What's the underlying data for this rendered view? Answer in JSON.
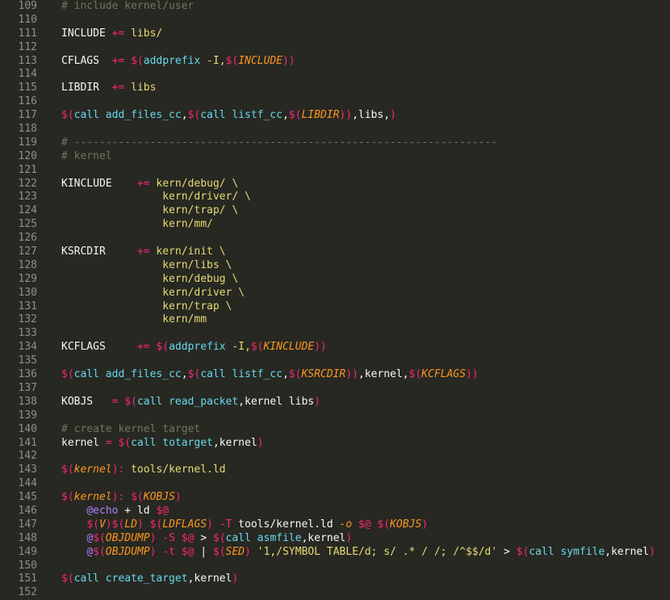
{
  "editor": {
    "lines": [
      {
        "n": "109",
        "tokens": [
          [
            "comment",
            "# include kernel/user"
          ]
        ]
      },
      {
        "n": "110",
        "tokens": []
      },
      {
        "n": "111",
        "tokens": [
          [
            "plain",
            "INCLUDE "
          ],
          [
            "op",
            "+="
          ],
          [
            "plain",
            " "
          ],
          [
            "string",
            "libs/"
          ]
        ]
      },
      {
        "n": "112",
        "tokens": []
      },
      {
        "n": "113",
        "tokens": [
          [
            "plain",
            "CFLAGS  "
          ],
          [
            "op",
            "+="
          ],
          [
            "plain",
            " "
          ],
          [
            "dollar",
            "$("
          ],
          [
            "func",
            "addprefix"
          ],
          [
            "string",
            " -I,"
          ],
          [
            "dollar",
            "$("
          ],
          [
            "var",
            "INCLUDE"
          ],
          [
            "paren",
            "))"
          ]
        ]
      },
      {
        "n": "114",
        "tokens": []
      },
      {
        "n": "115",
        "tokens": [
          [
            "plain",
            "LIBDIR  "
          ],
          [
            "op",
            "+="
          ],
          [
            "plain",
            " "
          ],
          [
            "string",
            "libs"
          ]
        ]
      },
      {
        "n": "116",
        "tokens": []
      },
      {
        "n": "117",
        "tokens": [
          [
            "dollar",
            "$("
          ],
          [
            "func",
            "call add_files_cc"
          ],
          [
            "plain",
            ","
          ],
          [
            "dollar",
            "$("
          ],
          [
            "func",
            "call listf_cc"
          ],
          [
            "plain",
            ","
          ],
          [
            "dollar",
            "$("
          ],
          [
            "var",
            "LIBDIR"
          ],
          [
            "paren",
            "))"
          ],
          [
            "plain",
            ",libs,"
          ],
          [
            "paren",
            ")"
          ]
        ]
      },
      {
        "n": "118",
        "tokens": []
      },
      {
        "n": "119",
        "tokens": [
          [
            "comment",
            "# -------------------------------------------------------------------"
          ]
        ]
      },
      {
        "n": "120",
        "tokens": [
          [
            "comment",
            "# kernel"
          ]
        ]
      },
      {
        "n": "121",
        "tokens": []
      },
      {
        "n": "122",
        "tokens": [
          [
            "plain",
            "KINCLUDE    "
          ],
          [
            "op",
            "+="
          ],
          [
            "plain",
            " "
          ],
          [
            "string",
            "kern/debug/ \\"
          ]
        ]
      },
      {
        "n": "123",
        "tokens": [
          [
            "plain",
            "                "
          ],
          [
            "string",
            "kern/driver/ \\"
          ]
        ]
      },
      {
        "n": "124",
        "tokens": [
          [
            "plain",
            "                "
          ],
          [
            "string",
            "kern/trap/ \\"
          ]
        ]
      },
      {
        "n": "125",
        "tokens": [
          [
            "plain",
            "                "
          ],
          [
            "string",
            "kern/mm/"
          ]
        ]
      },
      {
        "n": "126",
        "tokens": []
      },
      {
        "n": "127",
        "tokens": [
          [
            "plain",
            "KSRCDIR     "
          ],
          [
            "op",
            "+="
          ],
          [
            "plain",
            " "
          ],
          [
            "string",
            "kern/init \\"
          ]
        ]
      },
      {
        "n": "128",
        "tokens": [
          [
            "plain",
            "                "
          ],
          [
            "string",
            "kern/libs \\"
          ]
        ]
      },
      {
        "n": "129",
        "tokens": [
          [
            "plain",
            "                "
          ],
          [
            "string",
            "kern/debug \\"
          ]
        ]
      },
      {
        "n": "130",
        "tokens": [
          [
            "plain",
            "                "
          ],
          [
            "string",
            "kern/driver \\"
          ]
        ]
      },
      {
        "n": "131",
        "tokens": [
          [
            "plain",
            "                "
          ],
          [
            "string",
            "kern/trap \\"
          ]
        ]
      },
      {
        "n": "132",
        "tokens": [
          [
            "plain",
            "                "
          ],
          [
            "string",
            "kern/mm"
          ]
        ]
      },
      {
        "n": "133",
        "tokens": []
      },
      {
        "n": "134",
        "tokens": [
          [
            "plain",
            "KCFLAGS     "
          ],
          [
            "op",
            "+="
          ],
          [
            "plain",
            " "
          ],
          [
            "dollar",
            "$("
          ],
          [
            "func",
            "addprefix"
          ],
          [
            "string",
            " -I,"
          ],
          [
            "dollar",
            "$("
          ],
          [
            "var",
            "KINCLUDE"
          ],
          [
            "paren",
            "))"
          ]
        ]
      },
      {
        "n": "135",
        "tokens": []
      },
      {
        "n": "136",
        "tokens": [
          [
            "dollar",
            "$("
          ],
          [
            "func",
            "call add_files_cc"
          ],
          [
            "plain",
            ","
          ],
          [
            "dollar",
            "$("
          ],
          [
            "func",
            "call listf_cc"
          ],
          [
            "plain",
            ","
          ],
          [
            "dollar",
            "$("
          ],
          [
            "var",
            "KSRCDIR"
          ],
          [
            "paren",
            "))"
          ],
          [
            "plain",
            ",kernel,"
          ],
          [
            "dollar",
            "$("
          ],
          [
            "var",
            "KCFLAGS"
          ],
          [
            "paren",
            "))"
          ]
        ]
      },
      {
        "n": "137",
        "tokens": []
      },
      {
        "n": "138",
        "tokens": [
          [
            "plain",
            "KOBJS   "
          ],
          [
            "op",
            "="
          ],
          [
            "plain",
            " "
          ],
          [
            "dollar",
            "$("
          ],
          [
            "func",
            "call read_packet"
          ],
          [
            "plain",
            ",kernel libs"
          ],
          [
            "paren",
            ")"
          ]
        ]
      },
      {
        "n": "139",
        "tokens": []
      },
      {
        "n": "140",
        "tokens": [
          [
            "comment",
            "# create kernel target"
          ]
        ]
      },
      {
        "n": "141",
        "tokens": [
          [
            "plain",
            "kernel "
          ],
          [
            "op",
            "="
          ],
          [
            "plain",
            " "
          ],
          [
            "dollar",
            "$("
          ],
          [
            "func",
            "call totarget"
          ],
          [
            "plain",
            ",kernel"
          ],
          [
            "paren",
            ")"
          ]
        ]
      },
      {
        "n": "142",
        "tokens": []
      },
      {
        "n": "143",
        "tokens": [
          [
            "dollar",
            "$("
          ],
          [
            "var",
            "kernel"
          ],
          [
            "paren",
            "):"
          ],
          [
            "plain",
            " "
          ],
          [
            "string",
            "tools/kernel.ld"
          ]
        ]
      },
      {
        "n": "144",
        "tokens": []
      },
      {
        "n": "145",
        "tokens": [
          [
            "dollar",
            "$("
          ],
          [
            "var",
            "kernel"
          ],
          [
            "paren",
            "):"
          ],
          [
            "plain",
            " "
          ],
          [
            "dollar",
            "$("
          ],
          [
            "var",
            "KOBJS"
          ],
          [
            "paren",
            ")"
          ]
        ]
      },
      {
        "n": "146",
        "tokens": [
          [
            "plain",
            "    "
          ],
          [
            "at",
            "@echo"
          ],
          [
            "plain",
            " + ld "
          ],
          [
            "dollar",
            "$@"
          ]
        ]
      },
      {
        "n": "147",
        "tokens": [
          [
            "plain",
            "    "
          ],
          [
            "dollar",
            "$("
          ],
          [
            "var",
            "V"
          ],
          [
            "paren",
            ")"
          ],
          [
            "dollar",
            "$("
          ],
          [
            "var",
            "LD"
          ],
          [
            "paren",
            ")"
          ],
          [
            "plain",
            " "
          ],
          [
            "dollar",
            "$("
          ],
          [
            "var",
            "LDFLAGS"
          ],
          [
            "paren",
            ")"
          ],
          [
            "plain",
            " "
          ],
          [
            "flag",
            "-T"
          ],
          [
            "plain",
            " tools/kernel.ld "
          ],
          [
            "flagi",
            "-o"
          ],
          [
            "plain",
            " "
          ],
          [
            "dollar",
            "$@"
          ],
          [
            "plain",
            " "
          ],
          [
            "dollar",
            "$("
          ],
          [
            "var",
            "KOBJS"
          ],
          [
            "paren",
            ")"
          ]
        ]
      },
      {
        "n": "148",
        "tokens": [
          [
            "plain",
            "    "
          ],
          [
            "at",
            "@"
          ],
          [
            "dollar",
            "$("
          ],
          [
            "var",
            "OBJDUMP"
          ],
          [
            "paren",
            ")"
          ],
          [
            "plain",
            " "
          ],
          [
            "flag",
            "-S"
          ],
          [
            "plain",
            " "
          ],
          [
            "dollar",
            "$@"
          ],
          [
            "plain",
            " > "
          ],
          [
            "dollar",
            "$("
          ],
          [
            "func",
            "call asmfile"
          ],
          [
            "plain",
            ",kernel"
          ],
          [
            "paren",
            ")"
          ]
        ]
      },
      {
        "n": "149",
        "tokens": [
          [
            "plain",
            "    "
          ],
          [
            "at",
            "@"
          ],
          [
            "dollar",
            "$("
          ],
          [
            "var",
            "OBJDUMP"
          ],
          [
            "paren",
            ")"
          ],
          [
            "plain",
            " "
          ],
          [
            "flag",
            "-t"
          ],
          [
            "plain",
            " "
          ],
          [
            "dollar",
            "$@"
          ],
          [
            "plain",
            " | "
          ],
          [
            "dollar",
            "$("
          ],
          [
            "var",
            "SED"
          ],
          [
            "paren",
            ")"
          ],
          [
            "plain",
            " "
          ],
          [
            "string",
            "'1,/SYMBOL TABLE/d; s/ .* / /; /^$$/d'"
          ],
          [
            "plain",
            " > "
          ],
          [
            "dollar",
            "$("
          ],
          [
            "func",
            "call symfile"
          ],
          [
            "plain",
            ",kernel"
          ],
          [
            "paren",
            ")"
          ]
        ]
      },
      {
        "n": "150",
        "tokens": []
      },
      {
        "n": "151",
        "tokens": [
          [
            "dollar",
            "$("
          ],
          [
            "func",
            "call create_target"
          ],
          [
            "plain",
            ",kernel"
          ],
          [
            "paren",
            ")"
          ]
        ]
      },
      {
        "n": "152",
        "tokens": []
      }
    ]
  }
}
